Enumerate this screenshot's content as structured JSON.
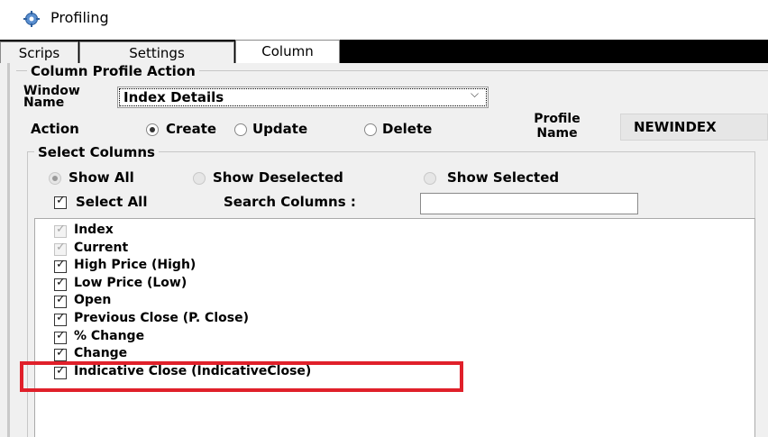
{
  "window": {
    "title": "Profiling",
    "icon": "gear-icon"
  },
  "tabs": [
    {
      "label": "Scrips",
      "active": false
    },
    {
      "label": "Settings",
      "active": false
    },
    {
      "label": "Column",
      "active": true
    }
  ],
  "column_profile": {
    "group_title": "Column Profile Action",
    "window_name_label_1": "Window",
    "window_name_label_2": "Name",
    "window_name_value": "Index Details",
    "action_label": "Action",
    "actions": [
      {
        "label": "Create",
        "selected": true
      },
      {
        "label": "Update",
        "selected": false
      },
      {
        "label": "Delete",
        "selected": false
      }
    ],
    "profile_name_label_1": "Profile",
    "profile_name_label_2": "Name",
    "profile_name_value": "NEWINDEX"
  },
  "select_columns": {
    "group_title": "Select Columns",
    "filters": [
      {
        "label": "Show All",
        "selected": true
      },
      {
        "label": "Show Deselected",
        "selected": false
      },
      {
        "label": "Show Selected",
        "selected": false
      }
    ],
    "select_all_label": "Select All",
    "select_all_checked": true,
    "search_label": "Search Columns :",
    "search_value": "",
    "items": [
      {
        "label": "Index",
        "checked": true,
        "enabled": false
      },
      {
        "label": "Current",
        "checked": true,
        "enabled": false
      },
      {
        "label": "High Price (High)",
        "checked": true,
        "enabled": true
      },
      {
        "label": "Low Price (Low)",
        "checked": true,
        "enabled": true
      },
      {
        "label": "Open",
        "checked": true,
        "enabled": true
      },
      {
        "label": "Previous Close (P. Close)",
        "checked": true,
        "enabled": true
      },
      {
        "label": "% Change",
        "checked": true,
        "enabled": true
      },
      {
        "label": "Change",
        "checked": true,
        "enabled": true
      },
      {
        "label": "Indicative Close (IndicativeClose)",
        "checked": true,
        "enabled": true,
        "highlighted": true
      }
    ]
  },
  "colors": {
    "highlight": "#e0202a",
    "panel": "#f0f0f0",
    "tabstrip": "#000000"
  }
}
